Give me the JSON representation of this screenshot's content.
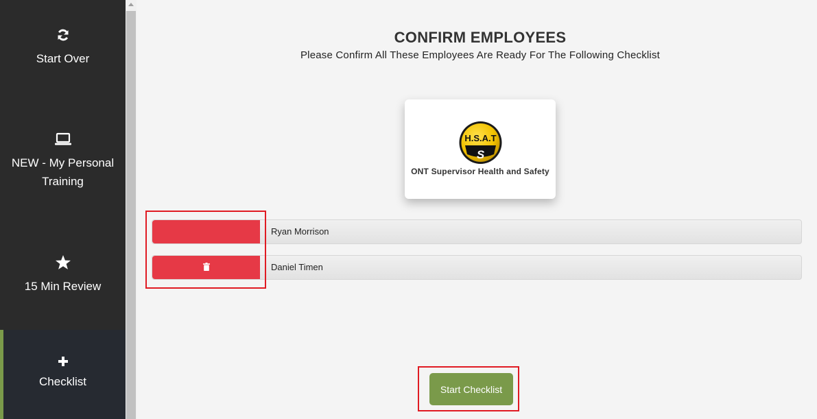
{
  "sidebar": {
    "items": [
      {
        "label": "Start Over",
        "icon": "refresh-icon"
      },
      {
        "label": "NEW - My Personal Training",
        "icon": "laptop-icon"
      },
      {
        "label": "15 Min Review",
        "icon": "star-icon"
      },
      {
        "label": "Checklist",
        "icon": "plus-icon",
        "active": true
      }
    ],
    "active_color": "#7a9a4a"
  },
  "header": {
    "title": "CONFIRM EMPLOYEES",
    "subtitle": "Please Confirm All These Employees Are Ready For The Following Checklist"
  },
  "checklist_card": {
    "logo_text": "H.S.A.T",
    "logo_letter": "S",
    "title": "ONT Supervisor Health and Safety"
  },
  "employees": [
    {
      "name": "Ryan Morrison"
    },
    {
      "name": "Daniel Timen"
    }
  ],
  "actions": {
    "start_label": "Start Checklist"
  },
  "colors": {
    "delete": "#e63946",
    "start": "#7a9a4a",
    "sidebar": "#2b2b2b",
    "highlight": "#e01a22"
  }
}
